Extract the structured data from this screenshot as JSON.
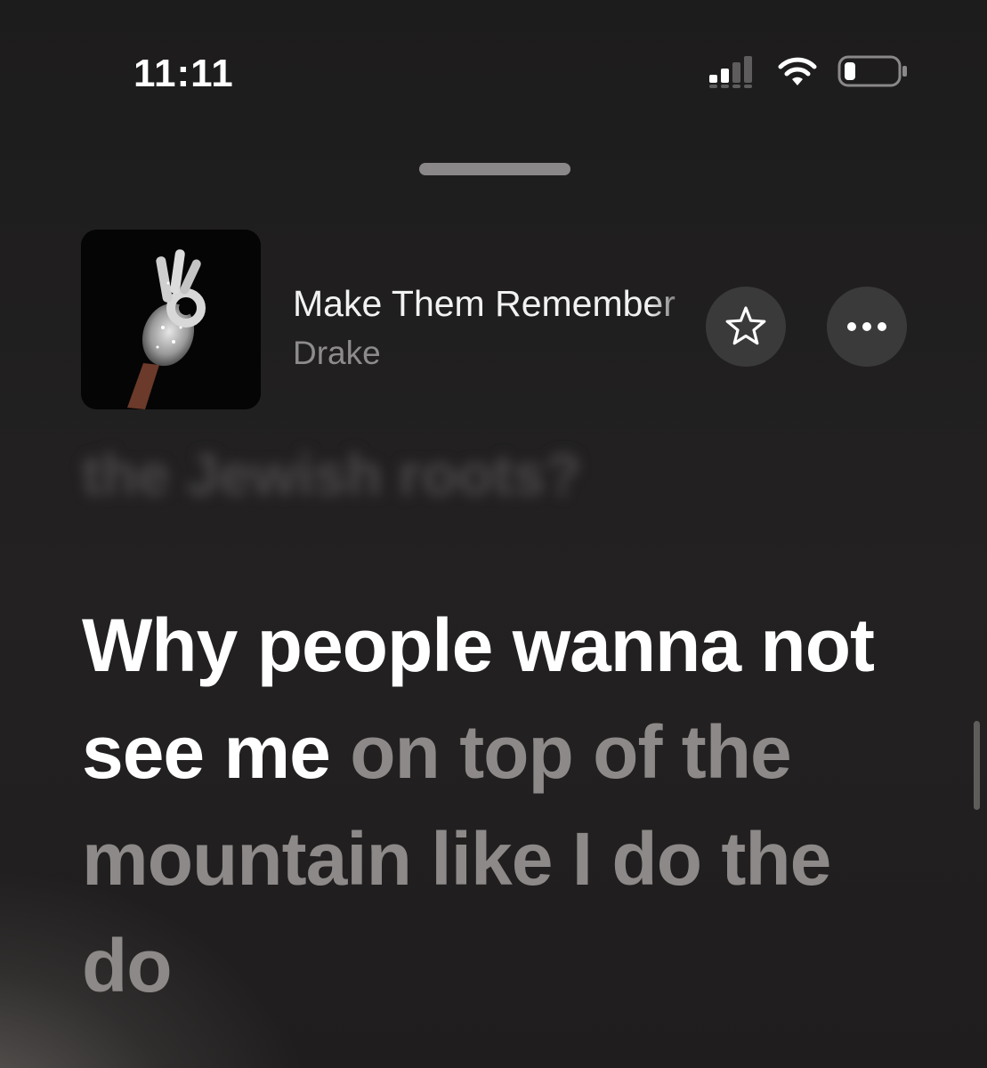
{
  "status_bar": {
    "time": "11:11",
    "icons": [
      "cellular-signal-icon",
      "wifi-icon",
      "battery-icon"
    ]
  },
  "now_playing": {
    "title": "Make Them Remember",
    "artist": "Drake",
    "artwork_icon": "album-art-hand-ok-gesture"
  },
  "actions": {
    "favorite_icon": "star-icon",
    "more_icon": "ellipsis-icon"
  },
  "lyrics": {
    "previous_line": "the Jewish roots?",
    "current_sung": "Why people wanna not see me",
    "current_unsung": "on top of the mountain like I do the do"
  },
  "colors": {
    "background": "#1c1b1b",
    "lyric_active": "#ffffff",
    "lyric_inactive": "#8c8988",
    "button_bg": "#3b3a3a"
  }
}
